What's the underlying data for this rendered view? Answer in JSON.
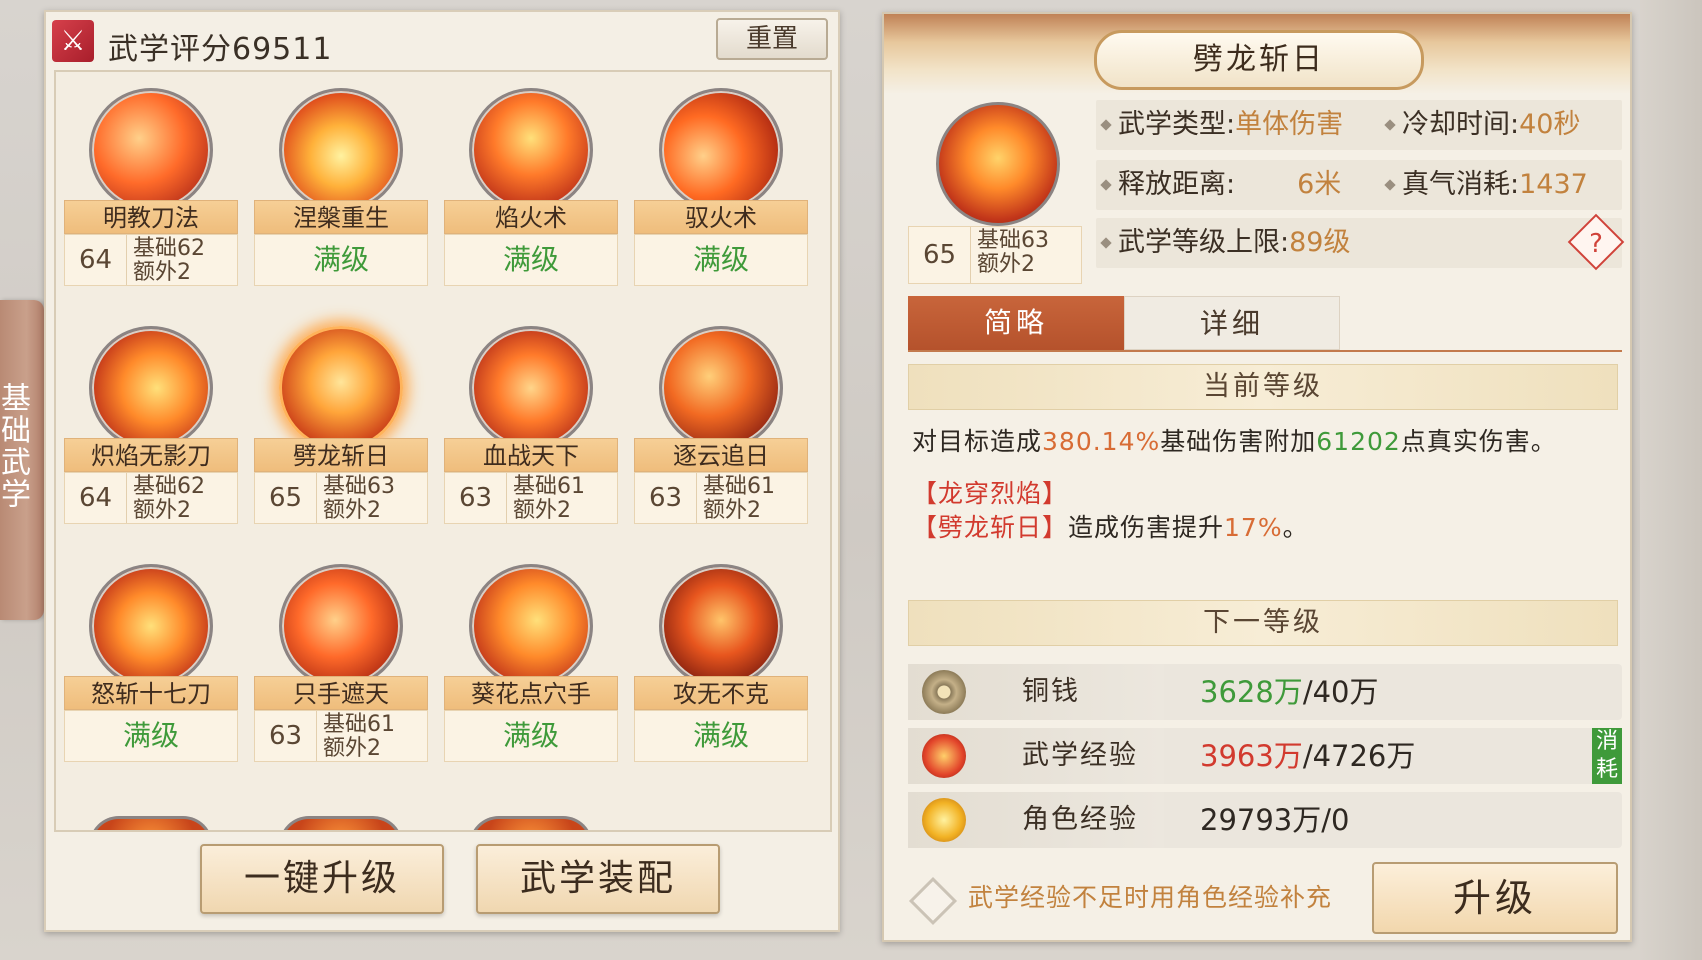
{
  "side_tab": {
    "label": "基础武学"
  },
  "header": {
    "score_label": "武学评分69511",
    "reset_label": "重置"
  },
  "skills": [
    {
      "name": "明教刀法",
      "max": false,
      "level": "64",
      "base": "基础62",
      "extra": "额外2"
    },
    {
      "name": "涅槃重生",
      "max": true,
      "max_label": "满级"
    },
    {
      "name": "焰火术",
      "max": true,
      "max_label": "满级"
    },
    {
      "name": "驭火术",
      "max": true,
      "max_label": "满级"
    },
    {
      "name": "炽焰无影刀",
      "max": false,
      "level": "64",
      "base": "基础62",
      "extra": "额外2"
    },
    {
      "name": "劈龙斩日",
      "max": false,
      "level": "65",
      "base": "基础63",
      "extra": "额外2",
      "selected": true
    },
    {
      "name": "血战天下",
      "max": false,
      "level": "63",
      "base": "基础61",
      "extra": "额外2"
    },
    {
      "name": "逐云追日",
      "max": false,
      "level": "63",
      "base": "基础61",
      "extra": "额外2"
    },
    {
      "name": "怒斩十七刀",
      "max": true,
      "max_label": "满级"
    },
    {
      "name": "只手遮天",
      "max": false,
      "level": "63",
      "base": "基础61",
      "extra": "额外2"
    },
    {
      "name": "葵花点穴手",
      "max": true,
      "max_label": "满级"
    },
    {
      "name": "攻无不克",
      "max": true,
      "max_label": "满级"
    }
  ],
  "bottom_buttons": {
    "one_key": "一键升级",
    "equip": "武学装配"
  },
  "detail": {
    "title": "劈龙斩日",
    "level": "65",
    "base": "基础63",
    "extra": "额外2",
    "type_label": "武学类型:",
    "type_value": "单体伤害",
    "cooldown_label": "冷却时间:",
    "cooldown_value": "40秒",
    "range_label": "释放距离:",
    "range_value": "6米",
    "qi_label": "真气消耗:",
    "qi_value": "1437",
    "level_cap_label": "武学等级上限:",
    "level_cap_value": "89级",
    "help": "?",
    "tab_brief": "简略",
    "tab_detail": "详细",
    "current_level_title": "当前等级",
    "desc_prefix": "对目标造成",
    "desc_pct": "380.14%",
    "desc_mid": "基础伤害附加",
    "desc_num": "61202",
    "desc_suffix": "点真实伤害。",
    "bonus1": "【龙穿烈焰】",
    "bonus2_tag": "【劈龙斩日】",
    "bonus2_text": "造成伤害提升",
    "bonus2_pct": "17%",
    "bonus2_end": "。",
    "next_level_title": "下一等级"
  },
  "resources": [
    {
      "label": "铜钱",
      "have": "3628万",
      "have_color": "green",
      "need": "/40万",
      "icon": "coin-icon",
      "consume": false
    },
    {
      "label": "武学经验",
      "have": "3963万",
      "have_color": "red",
      "need": "/4726万",
      "icon": "dragon-orb-icon",
      "consume": true,
      "consume_label": "消耗"
    },
    {
      "label": "角色经验",
      "have": "29793万",
      "have_color": "plain",
      "need": "/0",
      "icon": "gold-orb-icon",
      "consume": false
    }
  ],
  "supplement_label": "武学经验不足时用角色经验补充",
  "upgrade_label": "升级",
  "colors": {
    "accent": "#c8653b",
    "green": "#3f9a3a",
    "red": "#d23a2e",
    "orange": "#d86c35"
  }
}
